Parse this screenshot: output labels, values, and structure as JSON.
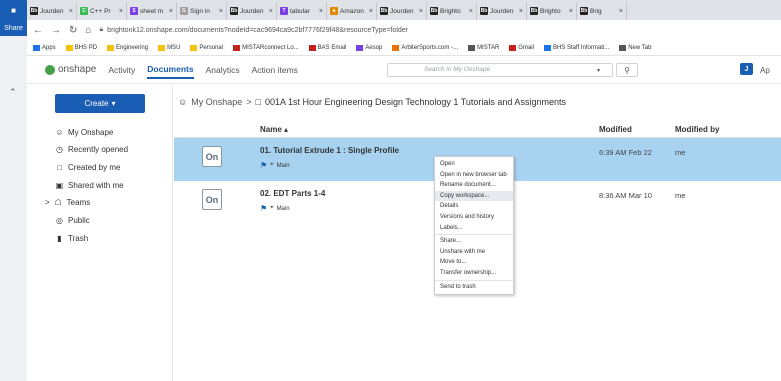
{
  "browser": {
    "share_label": "Share",
    "tabs": [
      {
        "icon": "Bb",
        "label": "Jourden",
        "color": "#222222"
      },
      {
        "icon": "C",
        "label": "C++ Pr",
        "color": "#3cba54"
      },
      {
        "icon": "S",
        "label": "sheet m",
        "color": "#7b3fe4"
      },
      {
        "icon": "G",
        "label": "Sign in",
        "color": "#9e9e9e"
      },
      {
        "icon": "Bb",
        "label": "Jourden",
        "color": "#222222"
      },
      {
        "icon": "T",
        "label": "tabular",
        "color": "#7b3fe4"
      },
      {
        "icon": "a",
        "label": "Amazon",
        "color": "#e08a00"
      },
      {
        "icon": "Bb",
        "label": "Jourden",
        "color": "#222222"
      },
      {
        "icon": "Bb",
        "label": "Brighto",
        "color": "#222222"
      },
      {
        "icon": "Bb",
        "label": "Jourden",
        "color": "#222222"
      },
      {
        "icon": "Bb",
        "label": "Brighto",
        "color": "#222222"
      },
      {
        "icon": "Bb",
        "label": "Brig",
        "color": "#222222"
      }
    ],
    "url": "brightonk12.onshape.com/documents?nodeId=cac9694ca9c2bf7776f29f48&resourceType=folder",
    "bookmarks": [
      {
        "label": "Apps",
        "color": "#1a73e8"
      },
      {
        "label": "BHS PD",
        "color": "#f4c20d"
      },
      {
        "label": "Engineering",
        "color": "#f4c20d"
      },
      {
        "label": "MSU",
        "color": "#f4c20d"
      },
      {
        "label": "Personal",
        "color": "#f4c20d"
      },
      {
        "label": "MISTARconnect Lo...",
        "color": "#c5221f"
      },
      {
        "label": "BAS Email",
        "color": "#c5221f"
      },
      {
        "label": "Aesop",
        "color": "#7b3fe4"
      },
      {
        "label": "ArbiterSports.com -...",
        "color": "#e8710a"
      },
      {
        "label": "MISTAR",
        "color": "#555555"
      },
      {
        "label": "Gmail",
        "color": "#c5221f"
      },
      {
        "label": "BHS Staff Informati...",
        "color": "#1a73e8"
      },
      {
        "label": "New Tab",
        "color": "#555555"
      }
    ]
  },
  "header": {
    "logo_text": "onshape",
    "nav": [
      "Activity",
      "Documents",
      "Analytics",
      "Action items"
    ],
    "active_nav": "Documents",
    "search_placeholder": "Search in My Onshape",
    "user_initial": "J",
    "user_label": "Ap"
  },
  "sidebar": {
    "create_label": "Create",
    "items": [
      {
        "icon": "user-circle-icon",
        "glyph": "☺",
        "label": "My Onshape"
      },
      {
        "icon": "clock-icon",
        "glyph": "◷",
        "label": "Recently opened"
      },
      {
        "icon": "document-icon",
        "glyph": "□",
        "label": "Created by me"
      },
      {
        "icon": "shared-icon",
        "glyph": "▣",
        "label": "Shared with me"
      },
      {
        "icon": "teams-icon",
        "glyph": "☖",
        "label": "Teams",
        "caret": ">"
      },
      {
        "icon": "globe-icon",
        "glyph": "◎",
        "label": "Public"
      },
      {
        "icon": "trash-icon",
        "glyph": "▮",
        "label": "Trash"
      }
    ]
  },
  "breadcrumb": {
    "root": "My Onshape",
    "separator": ">",
    "folder": "001A 1st Hour Engineering Design Technology 1 Tutorials and Assignments"
  },
  "table": {
    "headers": {
      "name": "Name ▴",
      "modified": "Modified",
      "modified_by": "Modified by"
    },
    "rows": [
      {
        "thumb": "On",
        "name": "01. Tutorial Extrude 1 : Single Profile",
        "branch": "Main",
        "modified": "6:39 AM Feb 22",
        "modified_by": "me",
        "selected": true
      },
      {
        "thumb": "On",
        "name": "02. EDT Parts 1-4",
        "branch": "Main",
        "modified": "8:36 AM Mar 10",
        "modified_by": "me",
        "selected": false
      }
    ]
  },
  "context_menu": {
    "groups": [
      [
        "Open",
        "Open in new browser tab",
        "Rename document...",
        "Copy workspace...",
        "Details",
        "Versions and history",
        "Labels..."
      ],
      [
        "Share...",
        "Unshare with me",
        "Move to...",
        "Transfer ownership..."
      ],
      [
        "Send to trash"
      ]
    ],
    "highlighted": "Copy workspace..."
  }
}
